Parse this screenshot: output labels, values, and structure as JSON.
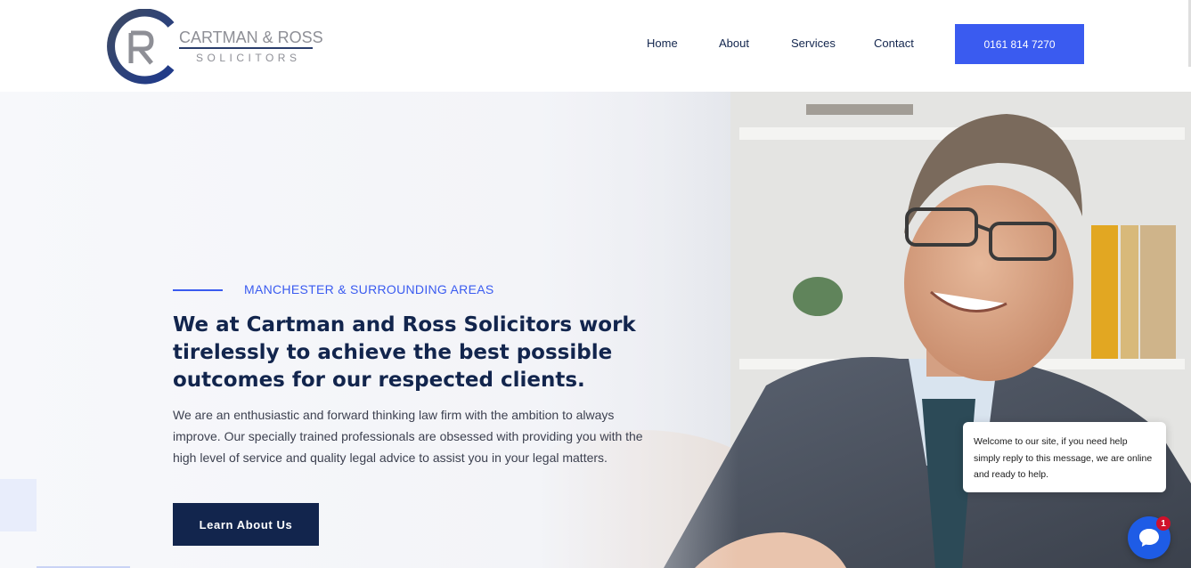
{
  "header": {
    "logo_name": "CARTMAN & ROSS",
    "logo_sub": "SOLICITORS",
    "nav": [
      "Home",
      "About",
      "Services",
      "Contact"
    ],
    "phone": "0161 814 7270"
  },
  "hero": {
    "eyebrow": "MANCHESTER & SURROUNDING AREAS",
    "headline": "We at Cartman and Ross Solicitors work tirelessly to achieve the best possible outcomes for our respected clients.",
    "body": "We are an enthusiastic and forward thinking law firm with the ambition to always improve. Our specially trained professionals are obsessed with providing you with the high level of service and quality legal advice to assist you in your legal matters.",
    "cta": "Learn About Us"
  },
  "chat": {
    "message": "Welcome to our site, if you need help simply reply to this message, we are online and ready to help.",
    "badge": "1",
    "launcher_icon": "chat-bubble-icon"
  },
  "colors": {
    "brand_navy": "#12254d",
    "accent_blue": "#3a5bf0",
    "chat_blue": "#1e5ce6",
    "badge_red": "#d0112b"
  }
}
